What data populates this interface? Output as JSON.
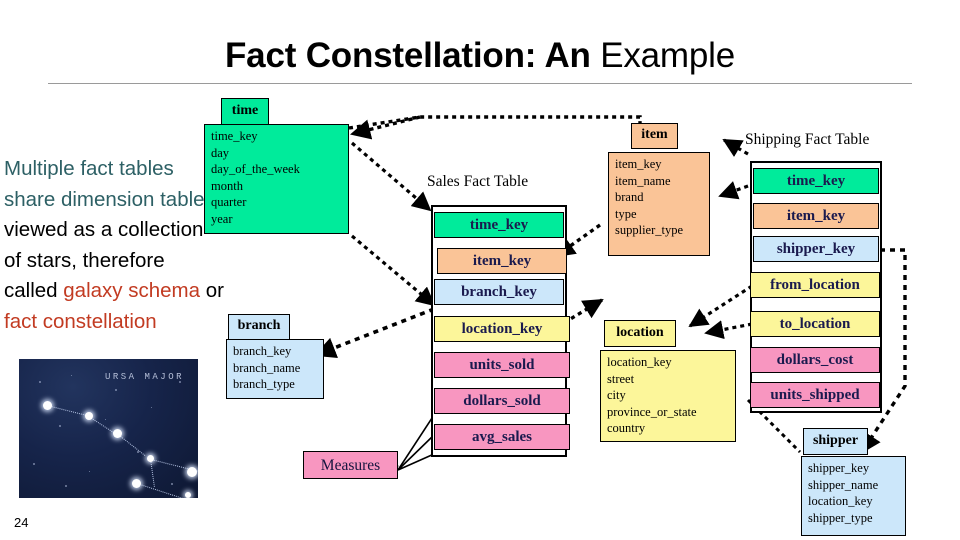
{
  "slide": {
    "title_bold": "Fact Constellation: An",
    "title_normal": " Example",
    "page_number": "24"
  },
  "body": {
    "line1": "Multiple fact tables",
    "line2": "share dimension tables",
    "line3": "viewed as a collection",
    "line4": "of stars, therefore",
    "line5_pre": "called ",
    "line5_em": "galaxy schema",
    "line5_post": " or",
    "line6": "fact constellation"
  },
  "picture": {
    "caption": "URSA MAJOR"
  },
  "dimensions": {
    "time": {
      "name": "time",
      "color": "#00eb9b",
      "fields": [
        "time_key",
        "day",
        "day_of_the_week",
        "month",
        "quarter",
        "year"
      ]
    },
    "branch": {
      "name": "branch",
      "color": "#cce7fa",
      "fields": [
        "branch_key",
        "branch_name",
        "branch_type"
      ]
    },
    "item": {
      "name": "item",
      "color": "#fac497",
      "fields": [
        "item_key",
        "item_name",
        "brand",
        "type",
        "supplier_type"
      ]
    },
    "location": {
      "name": "location",
      "color": "#fcf69a",
      "fields": [
        "location_key",
        "street",
        "city",
        "province_or_state",
        "country"
      ]
    },
    "shipper": {
      "name": "shipper",
      "color": "#cce7fa",
      "fields": [
        "shipper_key",
        "shipper_name",
        "location_key",
        "shipper_type"
      ]
    }
  },
  "facts": {
    "sales": {
      "caption": "Sales Fact Table",
      "rows": [
        {
          "label": "time_key",
          "color": "#00eb9b"
        },
        {
          "label": "item_key",
          "color": "#fac497"
        },
        {
          "label": "branch_key",
          "color": "#cce7fa"
        },
        {
          "label": "location_key",
          "color": "#fcf69a"
        },
        {
          "label": "units_sold",
          "color": "#f896c0"
        },
        {
          "label": "dollars_sold",
          "color": "#f896c0"
        },
        {
          "label": "avg_sales",
          "color": "#f896c0"
        }
      ]
    },
    "shipping": {
      "caption": "Shipping Fact Table",
      "rows": [
        {
          "label": "time_key",
          "color": "#00eb9b"
        },
        {
          "label": "item_key",
          "color": "#fac497"
        },
        {
          "label": "shipper_key",
          "color": "#cce7fa"
        },
        {
          "label": "from_location",
          "color": "#fcf69a"
        },
        {
          "label": "to_location",
          "color": "#fcf69a"
        },
        {
          "label": "dollars_cost",
          "color": "#f896c0"
        },
        {
          "label": "units_shipped",
          "color": "#f896c0"
        }
      ]
    }
  },
  "callout": {
    "measures": "Measures"
  }
}
